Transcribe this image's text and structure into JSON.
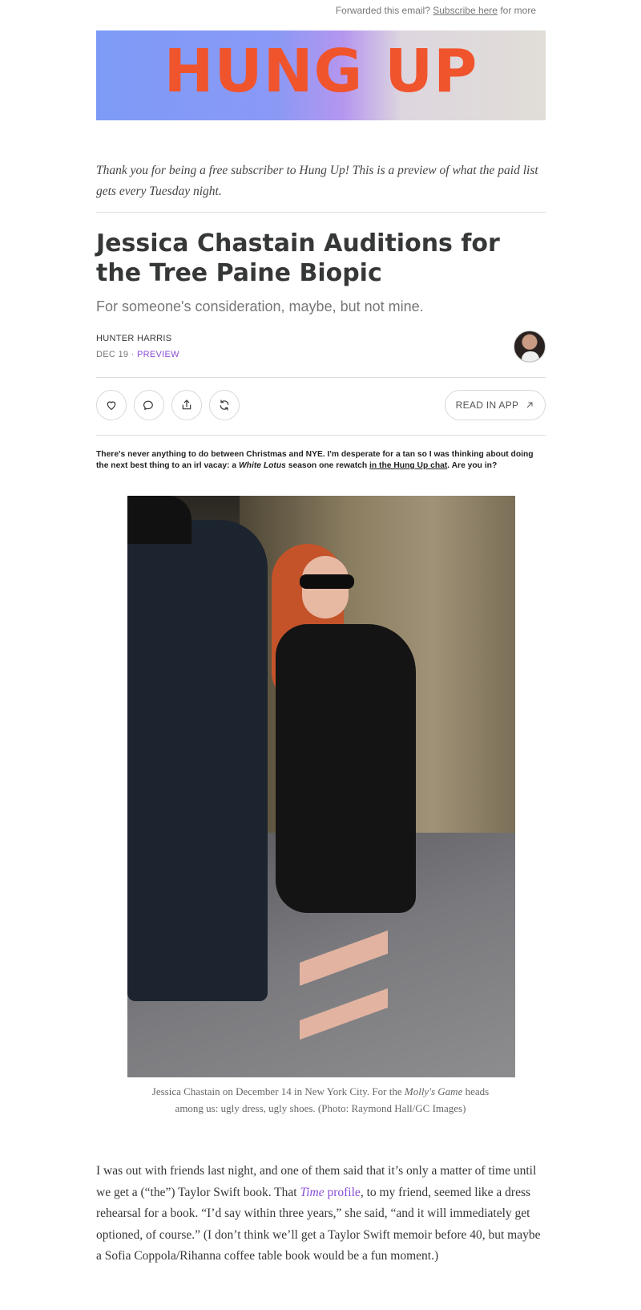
{
  "header": {
    "forward_prefix": "Forwarded this email?",
    "subscribe_link": "Subscribe here",
    "forward_suffix": "for more"
  },
  "banner": {
    "title": "HUNG UP"
  },
  "intro": "Thank you for being a free subscriber to Hung Up! This is a preview of what the paid list gets every Tuesday night.",
  "post": {
    "title": "Jessica Chastain Auditions for the Tree Paine Biopic",
    "subtitle": "For someone's consideration, maybe, but not mine.",
    "author": "HUNTER HARRIS",
    "date": "DEC 19",
    "separator": "·",
    "badge": "PREVIEW"
  },
  "actions": {
    "like_icon": "heart-icon",
    "comment_icon": "comment-icon",
    "share_icon": "share-icon",
    "restack_icon": "restack-icon",
    "read_in_app": "READ IN APP"
  },
  "note": {
    "part1": "There's never anything to do between Christmas and NYE. I'm desperate for a tan so I was thinking about doing the next best thing to an irl vacay: a ",
    "show": "White Lotus",
    "part2": " season one rewatch ",
    "link": "in the Hung Up chat",
    "part3": ". Are you in?"
  },
  "photo": {
    "caption_1": "Jessica Chastain on December 14 in New York City. For the ",
    "caption_title": "Molly's Game",
    "caption_2": " heads among us: ugly dress, ugly shoes. (Photo: Raymond Hall/GC Images)"
  },
  "body": {
    "p1_a": "I was out with friends last night, and one of them said that it’s only a matter of time until we get a (“the”) Taylor Swift book. That ",
    "p1_link_italic": "Time",
    "p1_link_rest": " profile",
    "p1_b": ", to my friend, seemed like a dress rehearsal for a book. “I’d say within three years,” she said, “and it will immediately get optioned, of course.” (I don’t think we’ll get a Taylor Swift memoir before 40, but maybe a Sofia Coppola/Rihanna coffee table book would be a fun moment.)"
  },
  "colors": {
    "accent": "#8a4dd6",
    "banner_title": "#f0542d",
    "banner_left": "#7d9bf6",
    "banner_right": "#e1ddd7"
  }
}
